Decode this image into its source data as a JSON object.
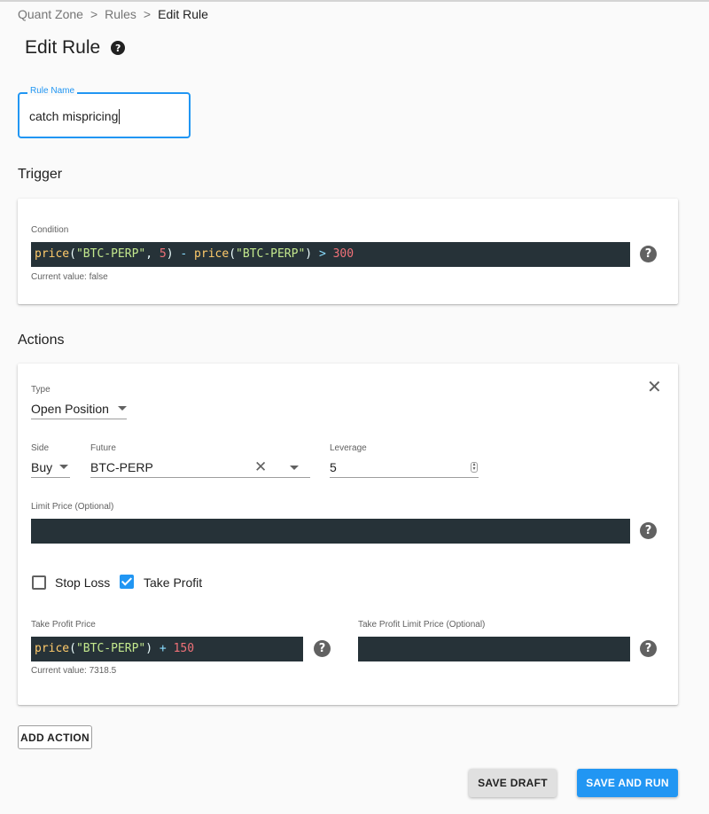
{
  "breadcrumb": {
    "items": [
      "Quant Zone",
      "Rules",
      "Edit Rule"
    ],
    "separator": ">"
  },
  "page": {
    "title": "Edit Rule",
    "help_icon": "help-circle-icon"
  },
  "rule_name": {
    "label": "Rule Name",
    "value": "catch mispricing"
  },
  "trigger": {
    "title": "Trigger",
    "condition_label": "Condition",
    "condition_tokens": [
      {
        "t": "price",
        "k": "fn"
      },
      {
        "t": "(",
        "k": "pun"
      },
      {
        "t": "\"BTC-PERP\"",
        "k": "str"
      },
      {
        "t": ", ",
        "k": "pun"
      },
      {
        "t": "5",
        "k": "num"
      },
      {
        "t": ") ",
        "k": "pun"
      },
      {
        "t": "- ",
        "k": "op"
      },
      {
        "t": "price",
        "k": "fn"
      },
      {
        "t": "(",
        "k": "pun"
      },
      {
        "t": "\"BTC-PERP\"",
        "k": "str"
      },
      {
        "t": ") ",
        "k": "pun"
      },
      {
        "t": "> ",
        "k": "op"
      },
      {
        "t": "300",
        "k": "num"
      }
    ],
    "current_value": "Current value: false"
  },
  "actions": {
    "title": "Actions",
    "type_label": "Type",
    "type_value": "Open Position",
    "side_label": "Side",
    "side_value": "Buy",
    "future_label": "Future",
    "future_value": "BTC-PERP",
    "leverage_label": "Leverage",
    "leverage_value": "5",
    "limit_price_label": "Limit Price (Optional)",
    "stop_loss_label": "Stop Loss",
    "stop_loss_checked": false,
    "take_profit_label": "Take Profit",
    "take_profit_checked": true,
    "tp_price_label": "Take Profit Price",
    "tp_price_tokens": [
      {
        "t": "price",
        "k": "fn"
      },
      {
        "t": "(",
        "k": "pun"
      },
      {
        "t": "\"BTC-PERP\"",
        "k": "str"
      },
      {
        "t": ") ",
        "k": "pun"
      },
      {
        "t": "+ ",
        "k": "op"
      },
      {
        "t": "150",
        "k": "num"
      }
    ],
    "tp_current_value": "Current value: 7318.5",
    "tp_limit_label": "Take Profit Limit Price (Optional)"
  },
  "buttons": {
    "add_action": "Add Action",
    "save_draft": "Save Draft",
    "save_and_run": "Save and Run"
  },
  "colors": {
    "accent": "#2196f3",
    "editor_bg": "#263238"
  }
}
